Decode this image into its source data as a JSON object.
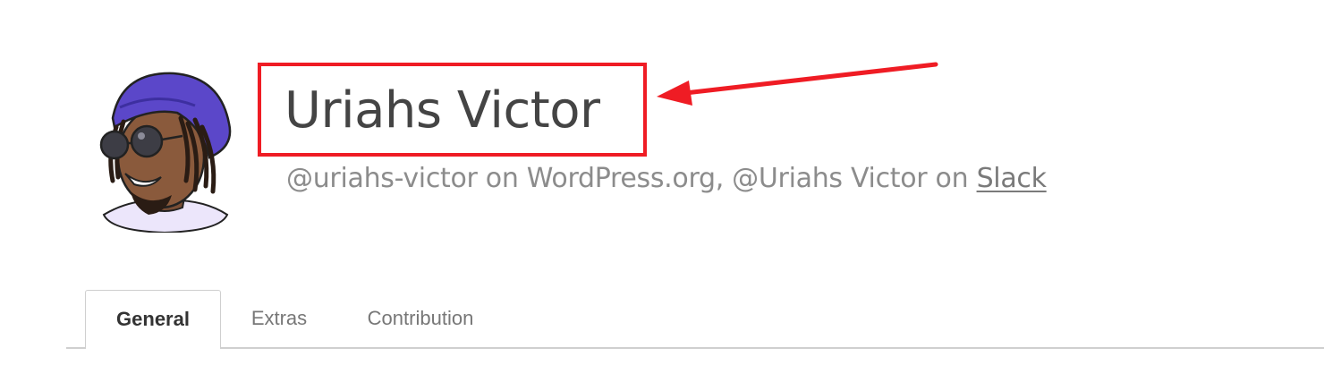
{
  "profile": {
    "display_name": "Uriahs Victor",
    "handles_prefix": "@uriahs-victor on WordPress.org, @Uriahs Victor on ",
    "slack_link": "Slack"
  },
  "tabs": [
    {
      "label": "General",
      "active": true
    },
    {
      "label": "Extras",
      "active": false
    },
    {
      "label": "Contribution",
      "active": false
    }
  ],
  "annotation": {
    "color": "#ef1c24"
  },
  "colors": {
    "name_text": "#444444",
    "handles_text": "#8c8c8c",
    "tab_border": "#cfcfcf"
  }
}
